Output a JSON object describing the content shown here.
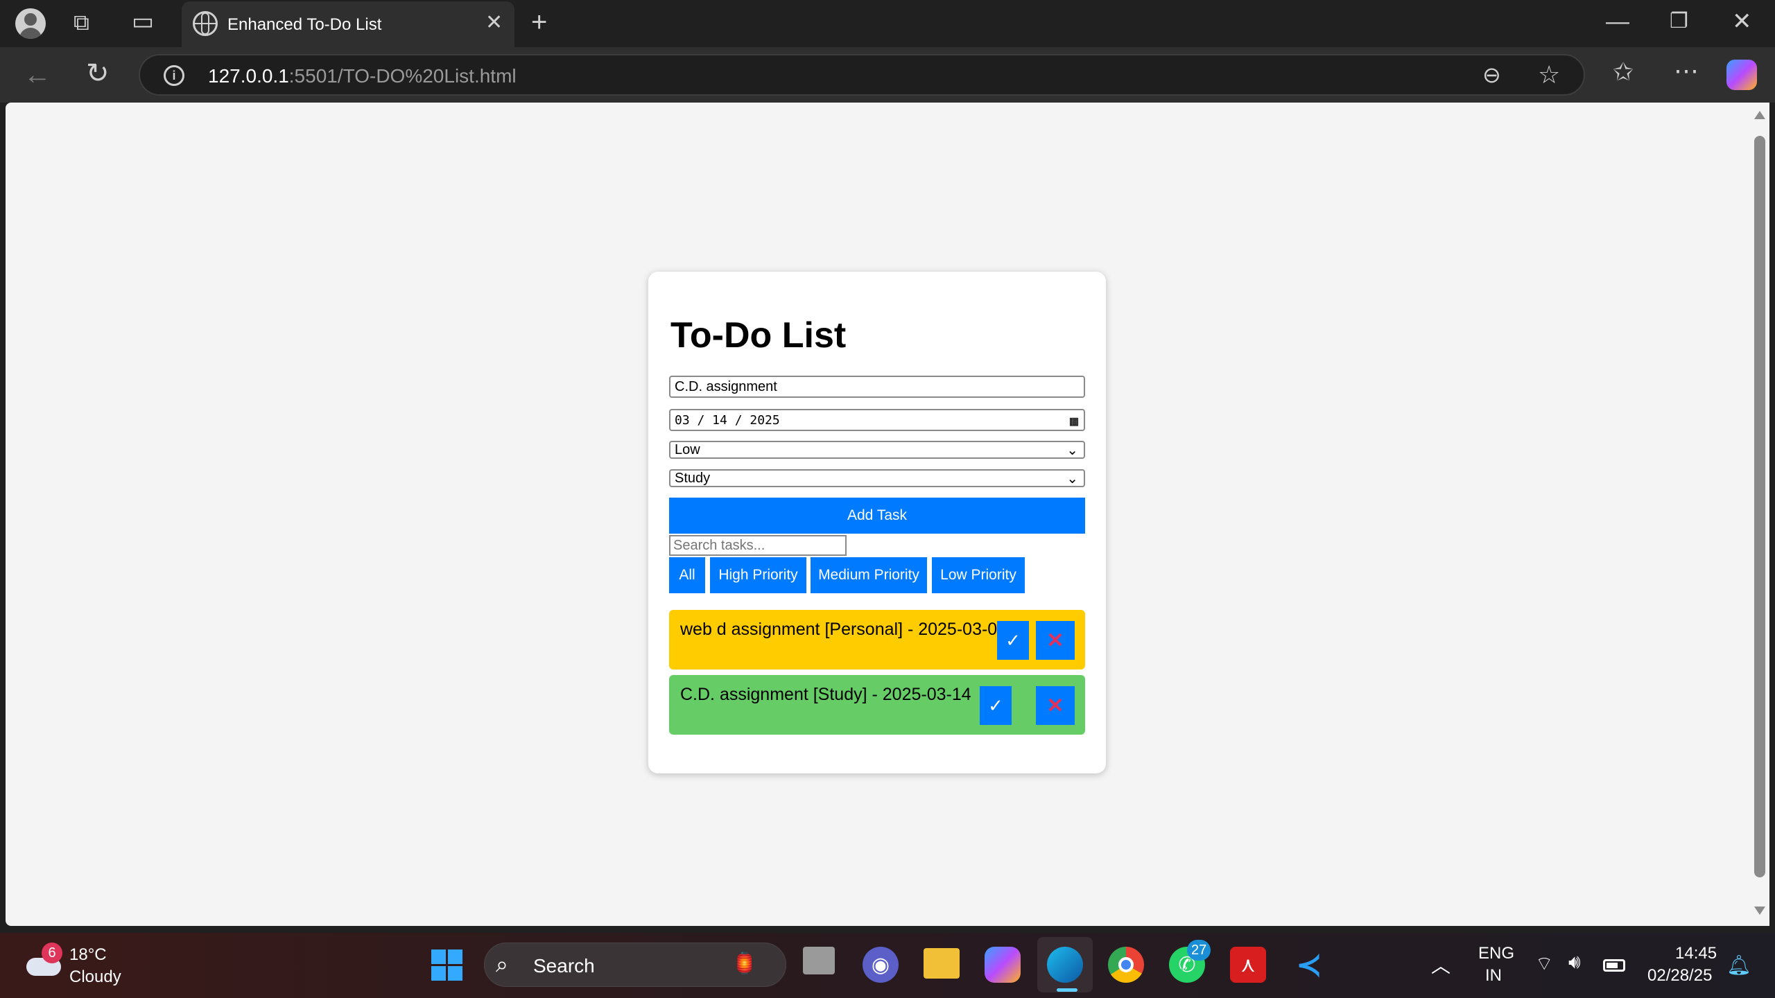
{
  "browser": {
    "tab_title": "Enhanced To-Do List",
    "url_host": "127.0.0.1",
    "url_rest": ":5501/TO-DO%20List.html"
  },
  "app": {
    "title": "To-Do List",
    "task_input_value": "C.D. assignment",
    "date_value": "03 / 14 / 2025",
    "priority_value": "Low",
    "category_value": "Study",
    "add_button": "Add Task",
    "search_placeholder": "Search tasks...",
    "filters": [
      "All",
      "High Priority",
      "Medium Priority",
      "Low Priority"
    ],
    "tasks": [
      {
        "text": "web d assignment [Personal] - 2025-03-05",
        "color": "#ffcc00"
      },
      {
        "text": "C.D. assignment [Study] - 2025-03-14",
        "color": "#66cc66"
      }
    ],
    "complete_glyph": "✓",
    "delete_glyph": "✕"
  },
  "taskbar": {
    "weather_temp": "18°C",
    "weather_desc": "Cloudy",
    "weather_badge": "6",
    "search_label": "Search",
    "whatsapp_badge": "27",
    "lang_top": "ENG",
    "lang_bottom": "IN",
    "time": "14:45",
    "date": "02/28/25"
  },
  "colors": {
    "accent": "#007bff",
    "task_high": "#ffcc00",
    "task_low": "#66cc66"
  }
}
